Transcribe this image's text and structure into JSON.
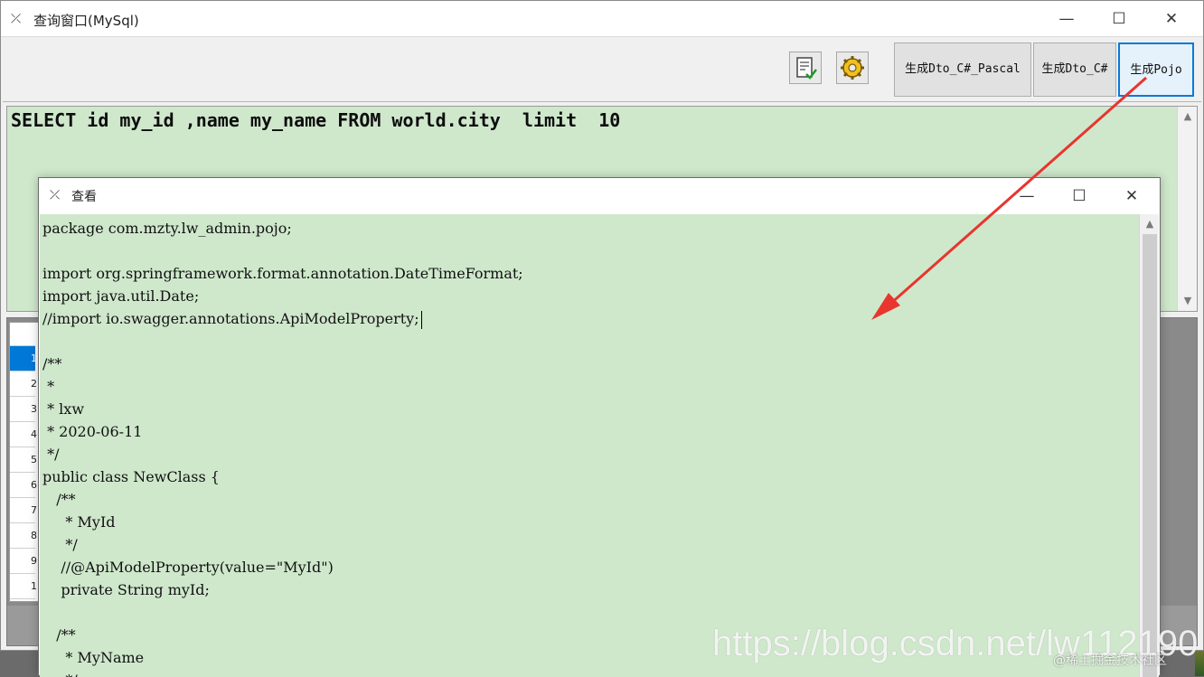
{
  "main_window": {
    "title": "查询窗口(MySql)",
    "controls": {
      "minimize": "—",
      "maximize": "☐",
      "close": "✕"
    }
  },
  "toolbar": {
    "icons": [
      "document-check-icon",
      "gear-icon"
    ],
    "buttons": [
      {
        "label": "生成Dto_C#_Pascal"
      },
      {
        "label": "生成Dto_C#"
      },
      {
        "label": "生成Pojo",
        "active": true
      }
    ]
  },
  "sql_editor": {
    "query": "SELECT id my_id ,name my_name FROM world.city  limit  10"
  },
  "result_grid": {
    "row_numbers": [
      "1",
      "2",
      "3",
      "4",
      "5",
      "6",
      "7",
      "8",
      "9",
      "1"
    ]
  },
  "view_window": {
    "title": "查看",
    "controls": {
      "minimize": "—",
      "maximize": "☐",
      "close": "✕"
    },
    "code_lines": [
      "package com.mzty.lw_admin.pojo;",
      "",
      "import org.springframework.format.annotation.DateTimeFormat;",
      "import java.util.Date;",
      "//import io.swagger.annotations.ApiModelProperty;",
      "",
      "/**",
      " *",
      " * lxw",
      " * 2020-06-11",
      " */",
      "public class NewClass {",
      "   /**",
      "     * MyId",
      "     */",
      "    //@ApiModelProperty(value=\"MyId\")",
      "    private String myId;",
      "",
      "   /**",
      "     * MyName",
      "     */"
    ]
  },
  "watermark": {
    "url": "https://blog.csdn.net/lw112190",
    "community": "@稀土掘金技术社区"
  },
  "colors": {
    "editor_bg": "#cfe8cc",
    "arrow": "#e8352e",
    "active_button_border": "#0a79d6"
  }
}
